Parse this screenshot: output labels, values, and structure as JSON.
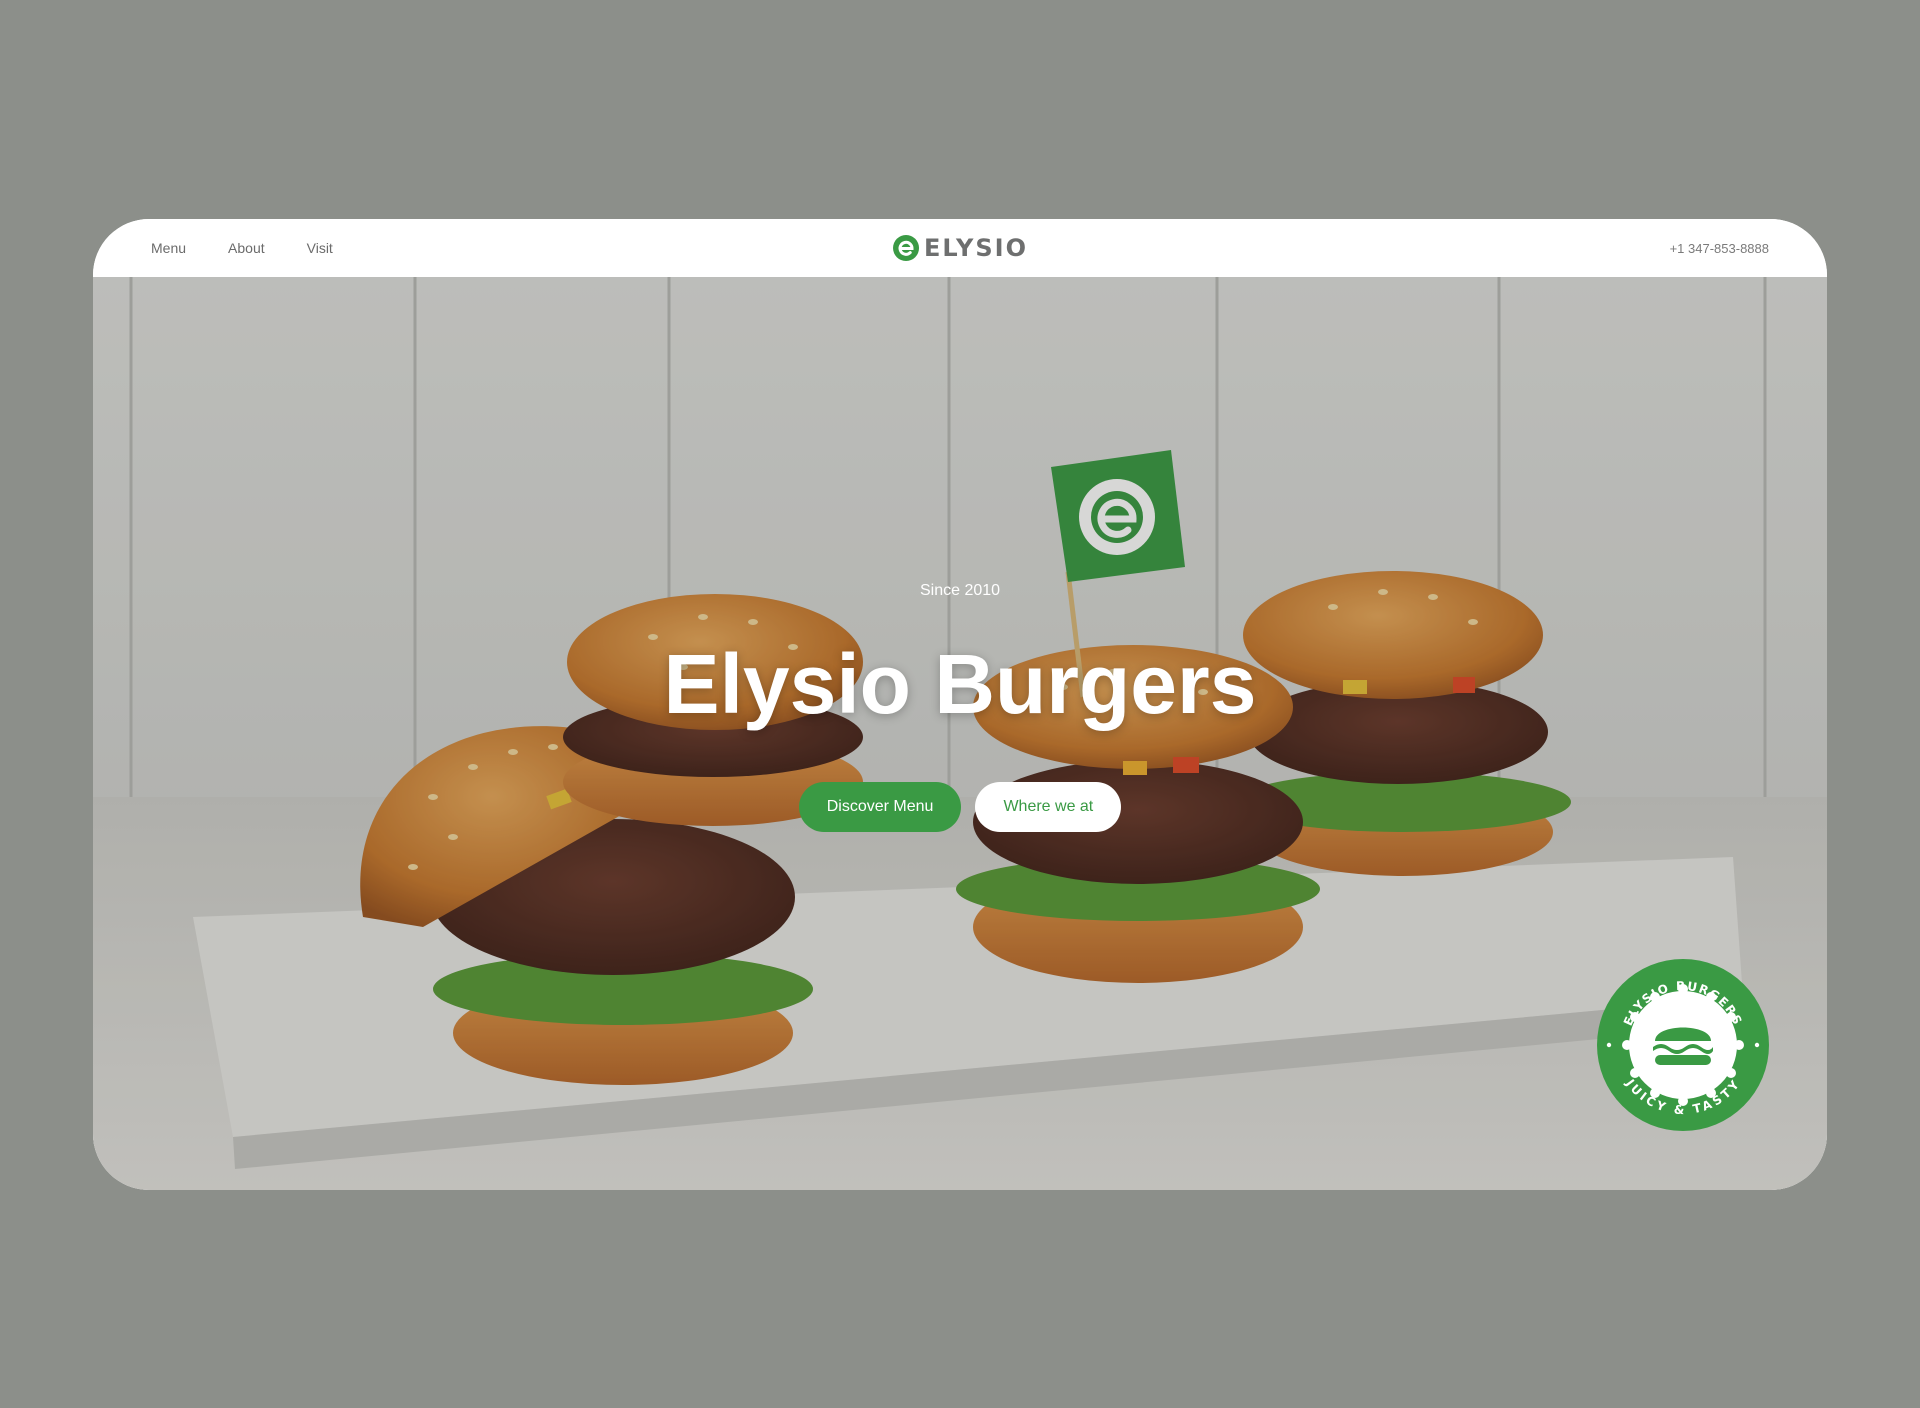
{
  "nav": {
    "links": [
      "Menu",
      "About",
      "Visit"
    ],
    "logo_text": "ELYSIO",
    "phone": "+1 347-853-8888"
  },
  "hero": {
    "eyebrow": "Since 2010",
    "title": "Elysio Burgers",
    "primary_button": "Discover Menu",
    "secondary_button": "Where we at",
    "flag_icon": "elysio-e-logo",
    "background": "four burgers on marble board against white wood wall"
  },
  "badge": {
    "top_text": "ELYSIO BURGERS",
    "bottom_text": "JUICY & TASTY",
    "icon": "burger-icon"
  },
  "colors": {
    "brand_green": "#3a9a44",
    "page_background": "#8c8f8a",
    "nav_text": "#6b6b6b"
  }
}
